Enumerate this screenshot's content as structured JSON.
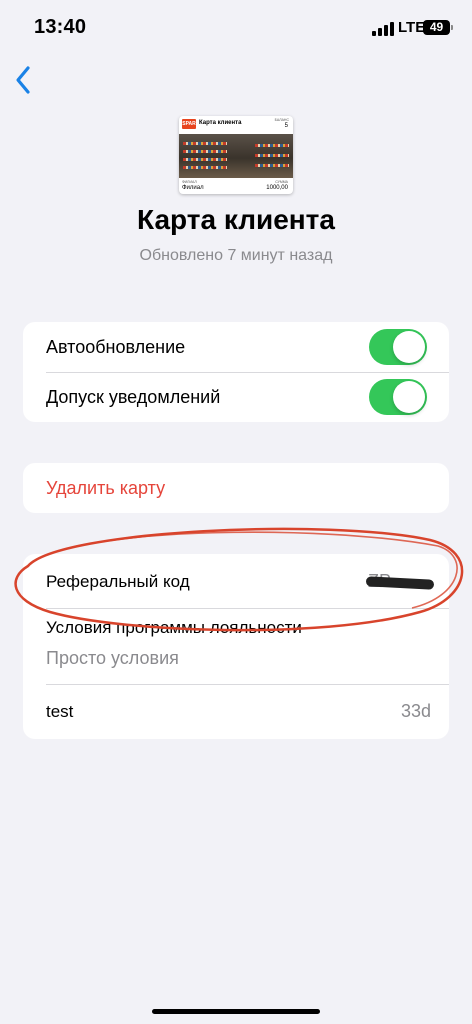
{
  "status_bar": {
    "time": "13:40",
    "network": "LTE",
    "battery": "49"
  },
  "card": {
    "logo": "SPAR",
    "name": "Карта клиента",
    "balance_label": "БАЛАНС",
    "balance": "5",
    "branch_label": "ФИЛИАЛ",
    "branch": "Филиал",
    "amount_label": "СУММА",
    "amount": "1000,00"
  },
  "header": {
    "title": "Карта клиента",
    "subtitle": "Обновлено 7 минут назад"
  },
  "settings": {
    "auto_update_label": "Автообновление",
    "auto_update_on": true,
    "notifications_label": "Допуск уведомлений",
    "notifications_on": true
  },
  "actions": {
    "delete_label": "Удалить карту"
  },
  "info": {
    "referral_label": "Реферальный код",
    "referral_value": "ZP",
    "terms_label": "Условия программы лояльности",
    "terms_value": "Просто условия",
    "test_label": "test",
    "test_value": "33d"
  },
  "colors": {
    "toggle_on": "#34c759",
    "destructive": "#e5453b",
    "accent": "#1a82e6",
    "annotation": "#d8442c"
  }
}
